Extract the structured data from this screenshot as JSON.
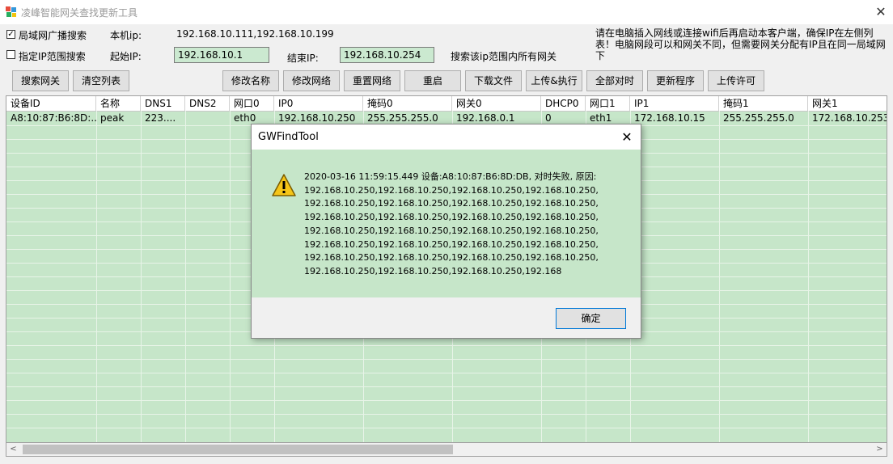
{
  "window": {
    "title": "凌峰智能网关查找更新工具",
    "close_glyph": "✕"
  },
  "options": {
    "broadcast_label": "局域网广播搜索",
    "broadcast_checked": true,
    "range_label": "指定IP范围搜索",
    "range_checked": false,
    "local_ip_label": "本机ip:",
    "local_ip_value": "192.168.10.111,192.168.10.199",
    "start_ip_label": "起始IP:",
    "start_ip_value": "192.168.10.1",
    "end_ip_label": "结束IP:",
    "end_ip_value": "192.168.10.254",
    "range_hint": "搜索该ip范围内所有网关",
    "right_hint": "请在电脑插入网线或连接wifi后再启动本客户端，确保IP在左侧列表！电脑网段可以和网关不同，但需要网关分配有IP且在同一局域网下"
  },
  "toolbar": {
    "search_label": "搜索网关",
    "clear_label": "清空列表",
    "rename_label": "修改名称",
    "edit_network_label": "修改网络",
    "reset_network_label": "重置网络",
    "reboot_label": "重启",
    "download_label": "下载文件",
    "upload_exec_label": "上传&执行",
    "sync_time_label": "全部对时",
    "update_label": "更新程序",
    "upload_license_label": "上传许可"
  },
  "table": {
    "columns": [
      "设备ID",
      "名称",
      "DNS1",
      "DNS2",
      "网口0",
      "IP0",
      "掩码0",
      "网关0",
      "DHCP0",
      "网口1",
      "IP1",
      "掩码1",
      "网关1"
    ],
    "rows": [
      [
        "A8:10:87:B6:8D:...",
        "peak",
        "223....",
        "",
        "eth0",
        "192.168.10.250",
        "255.255.255.0",
        "192.168.0.1",
        "0",
        "eth1",
        "172.168.10.15",
        "255.255.255.0",
        "172.168.10.253"
      ]
    ]
  },
  "scrollbar": {
    "left_glyph": "<",
    "right_glyph": ">"
  },
  "dialog": {
    "title": "GWFindTool",
    "close_glyph": "✕",
    "message": "2020-03-16 11:59:15.449  设备:A8:10:87:B6:8D:DB, 对时失败, 原因: 192.168.10.250,192.168.10.250,192.168.10.250,192.168.10.250,192.168.10.250,192.168.10.250,192.168.10.250,192.168.10.250,192.168.10.250,192.168.10.250,192.168.10.250,192.168.10.250,192.168.10.250,192.168.10.250,192.168.10.250,192.168.10.250,192.168.10.250,192.168.10.250,192.168.10.250,192.168.10.250,192.168.10.250,192.168.10.250,192.168.10.250,192.168.10.250,192.168.10.250,192.168.10.250,192.168.10.250,192.168",
    "ok_label": "确定",
    "icon": "warning-icon"
  },
  "colors": {
    "grid_bg": "#c6e6c9",
    "field_bg": "#cbe9d0",
    "warning": "#f5c518"
  }
}
